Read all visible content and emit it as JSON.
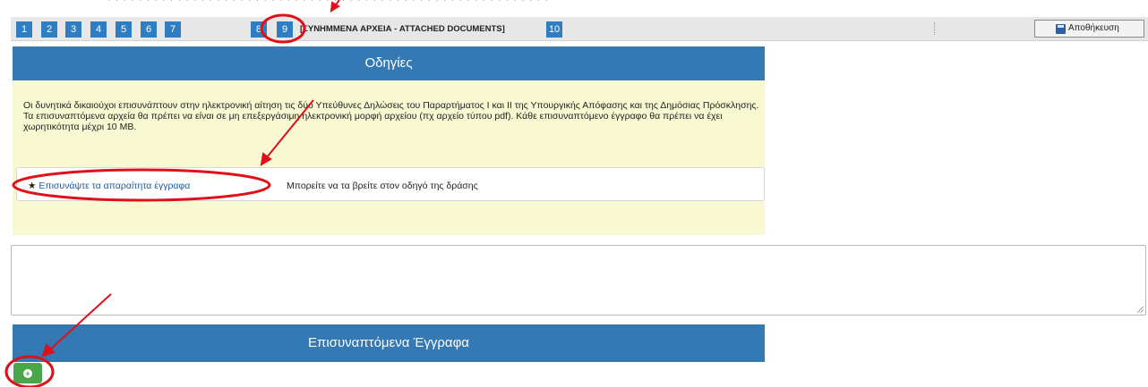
{
  "steps": {
    "items": [
      "1",
      "2",
      "3",
      "4",
      "5",
      "6",
      "7",
      "8",
      "9",
      "10"
    ],
    "active_label": "[ΣΥΝΗΜΜΕΝΑ ΑΡΧΕΙΑ - ATTACHED DOCUMENTS]",
    "color": "#2f7ec1"
  },
  "toolbar": {
    "save_label": "Αποθήκευση",
    "save_icon": "floppy-disk-icon"
  },
  "instructions": {
    "title": "Οδηγίες",
    "paragraph": "Οι δυνητικά δικαιούχοι επισυνάπτουν στην ηλεκτρονική αίτηση τις δύο Υπεύθυνες Δηλώσεις του Παραρτήματος Ι και ΙΙ της Υπουργικής Απόφασης και της Δημόσιας Πρόσκλησης.",
    "paragraph2": "Τα επισυναπτόμενα αρχεία θα πρέπει να είναι σε μη επεξεργάσιμη ηλεκτρονική μορφή αρχείου (πχ αρχείο τύπου pdf). Κάθε επισυναπτόμενο έγγραφο θα πρέπει να έχει χωρητικότητα μέχρι 10 MB.",
    "attach_link": "Επισυνάψτε τα απαραίτητα έγγραφα",
    "attach_hint": "Μπορείτε να τα βρείτε στον οδηγό της δράσης",
    "header_color": "#3478b4",
    "body_color": "#f8f8d2"
  },
  "notes": {
    "value": ""
  },
  "documents": {
    "title": "Επισυναπτόμενα Έγγραφα",
    "add_icon": "plus-circle-icon",
    "add_color": "#4aa64a"
  },
  "annotations": {
    "color": "#e0101a"
  }
}
